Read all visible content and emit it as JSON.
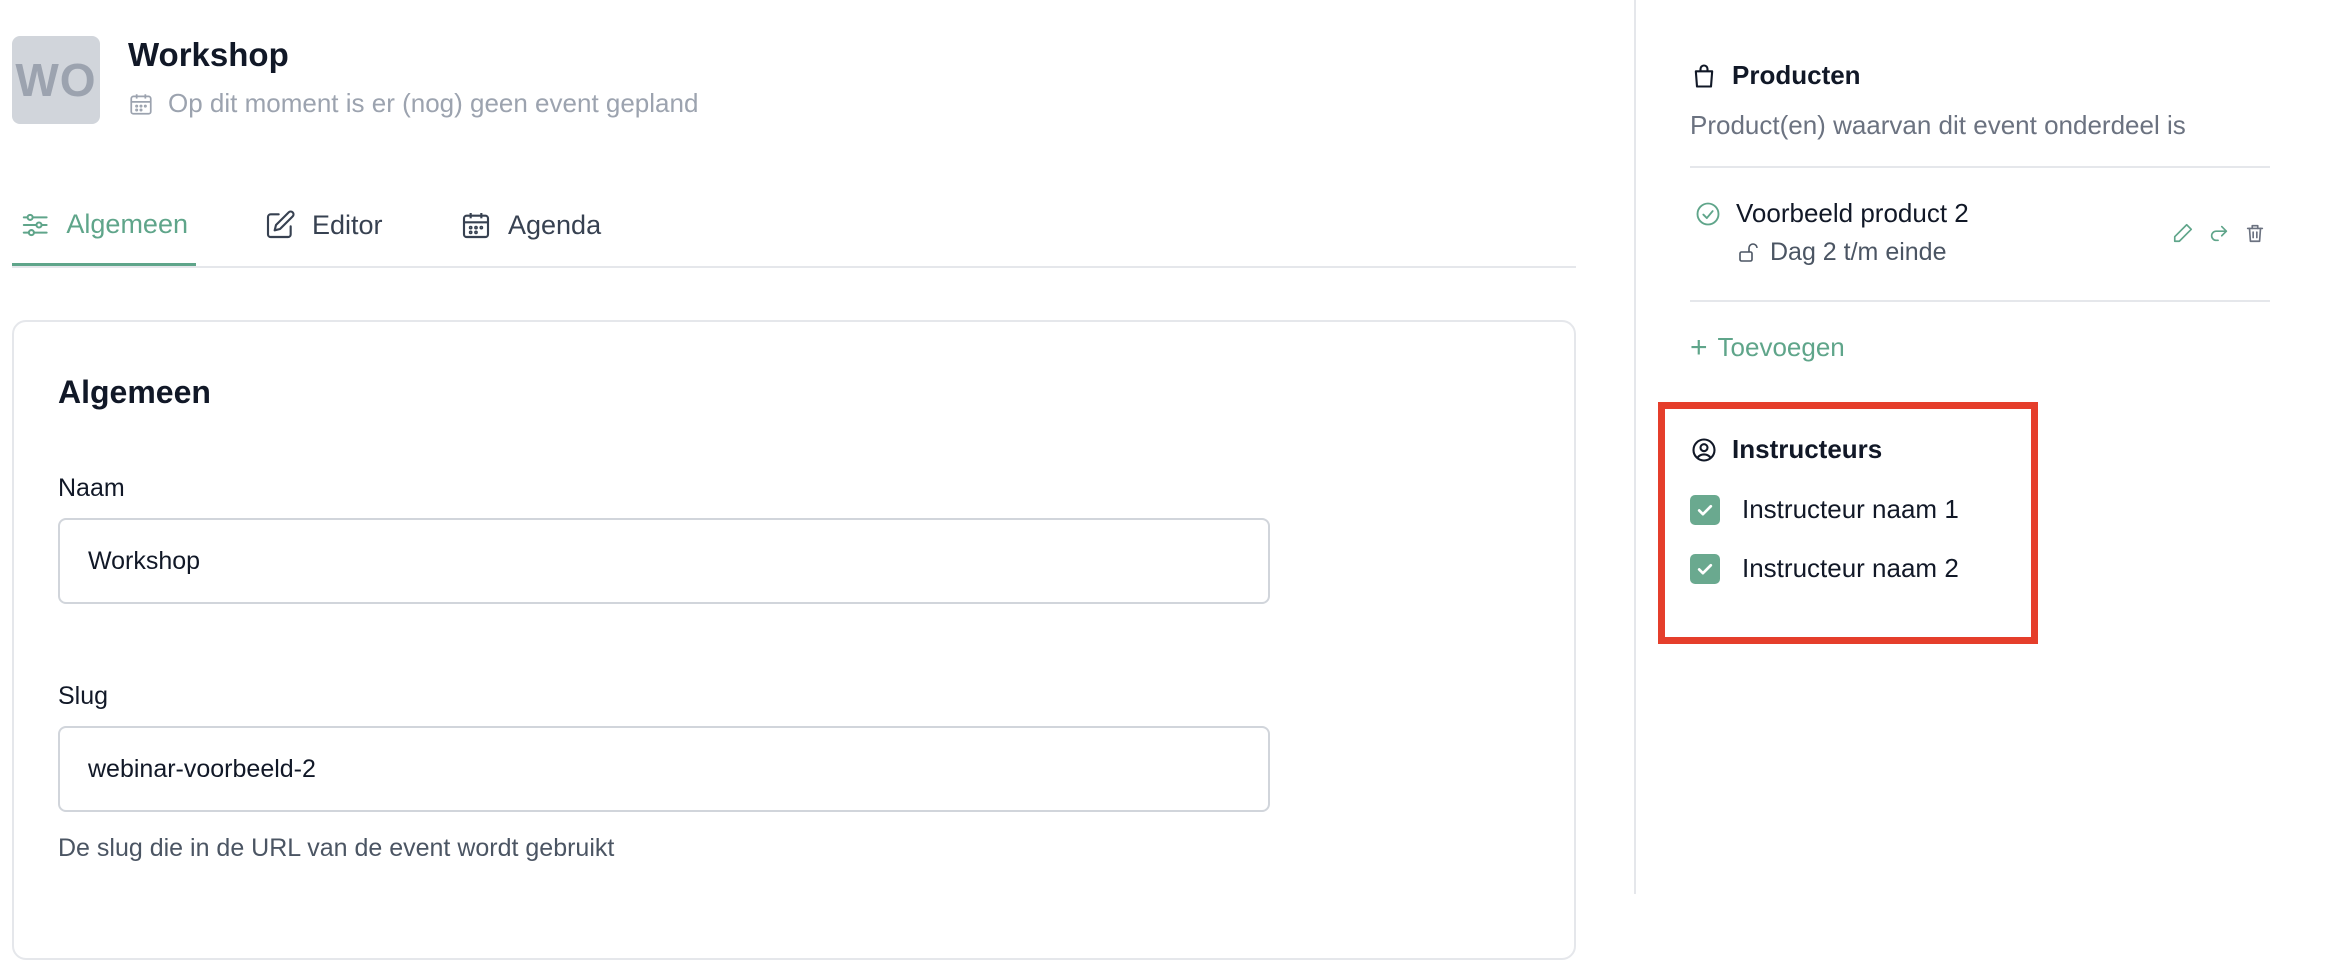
{
  "header": {
    "avatar_initials": "WO",
    "title": "Workshop",
    "subtitle": "Op dit moment is er (nog) geen event gepland"
  },
  "tabs": [
    {
      "label": "Algemeen",
      "icon": "sliders-icon",
      "active": true
    },
    {
      "label": "Editor",
      "icon": "edit-icon",
      "active": false
    },
    {
      "label": "Agenda",
      "icon": "calendar-icon",
      "active": false
    }
  ],
  "card": {
    "title": "Algemeen",
    "name_label": "Naam",
    "name_value": "Workshop",
    "slug_label": "Slug",
    "slug_value": "webinar-voorbeeld-2",
    "slug_help": "De slug die in de URL van de event wordt gebruikt"
  },
  "products": {
    "heading": "Producten",
    "description": "Product(en) waarvan dit event onderdeel is",
    "items": [
      {
        "name": "Voorbeeld product 2",
        "access": "Dag 2 t/m einde"
      }
    ],
    "add_label": "Toevoegen"
  },
  "instructors": {
    "heading": "Instructeurs",
    "items": [
      {
        "name": "Instructeur naam 1",
        "checked": true
      },
      {
        "name": "Instructeur naam 2",
        "checked": true
      }
    ]
  },
  "colors": {
    "accent": "#5fa58a",
    "highlight": "#e53e2b"
  }
}
